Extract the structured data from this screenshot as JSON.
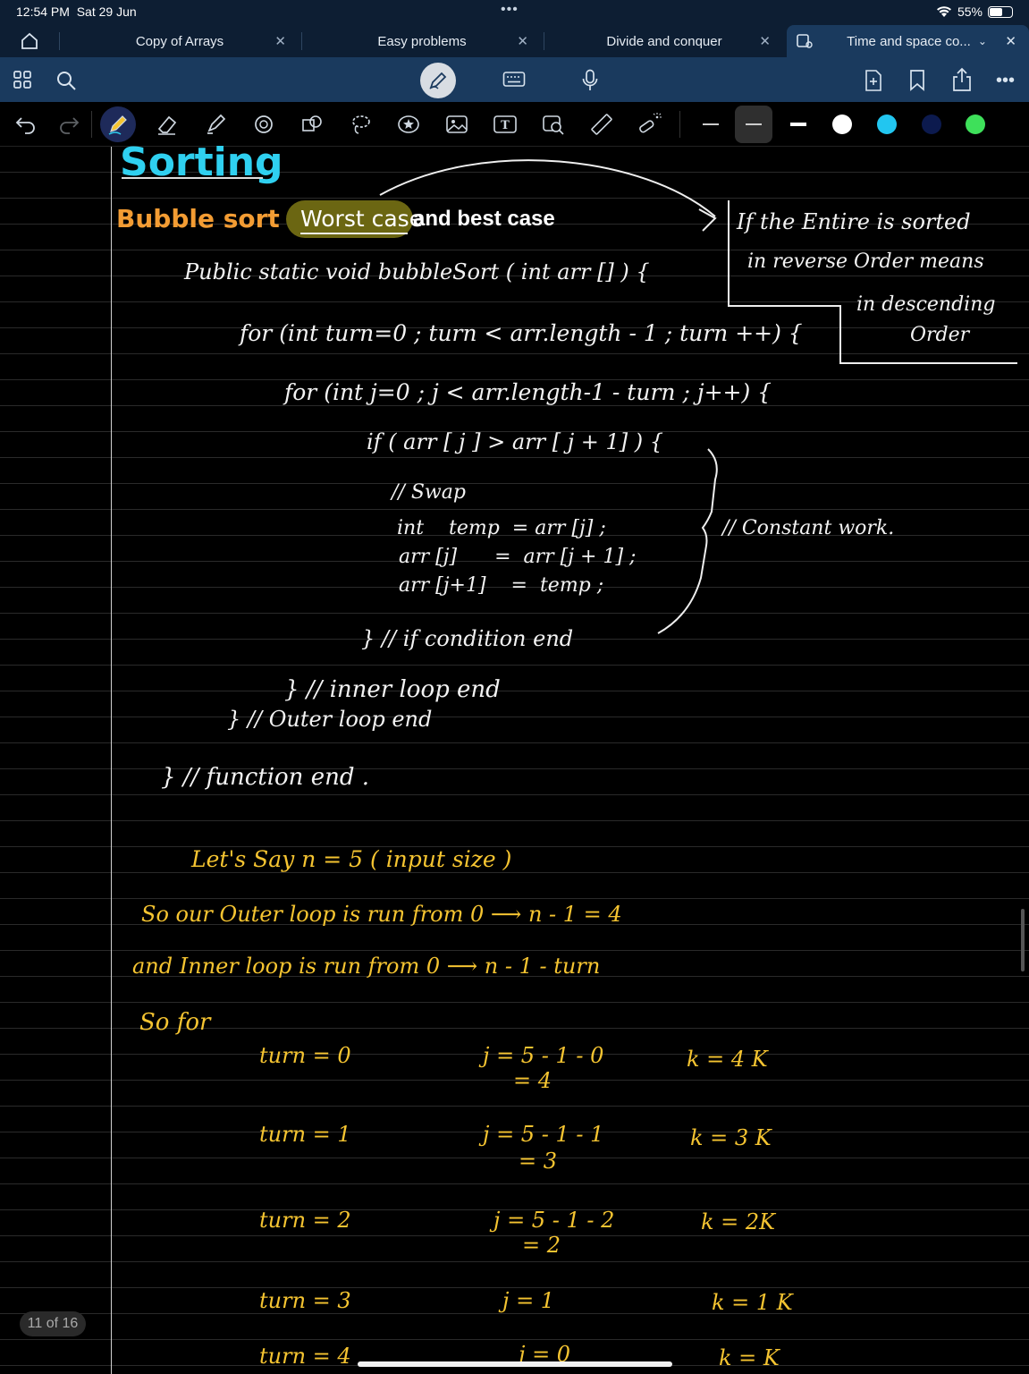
{
  "status_bar": {
    "time": "12:54 PM",
    "date": "Sat 29 Jun",
    "battery": "55%"
  },
  "tabs": [
    {
      "label": "Copy of Arrays"
    },
    {
      "label": "Easy problems"
    },
    {
      "label": "Divide and conquer"
    },
    {
      "label": "Time and space co..."
    }
  ],
  "icons": {
    "home": "home-icon",
    "grid": "grid-icon",
    "search": "search-icon",
    "pen_mode": "pen-mode-icon",
    "keyboard": "keyboard-icon",
    "mic": "microphone-icon",
    "add_page": "add-page-icon",
    "bookmark": "bookmark-icon",
    "share": "share-icon",
    "more": "more-icon"
  },
  "colors": {
    "swatches": [
      "#ffffff",
      "#22c6f0",
      "#0c1a4e",
      "#3ee05a"
    ],
    "accent": "#1a3a5e"
  },
  "note": {
    "title": "Sorting",
    "heading": "Bubble sort",
    "highlight": "Worst case",
    "heading_rest": "and best case",
    "side_note": [
      "If the Entire is sorted",
      "in reverse Order means",
      "in descending",
      "Order"
    ],
    "code": [
      "Public static void bubbleSort ( int arr [] ) {",
      "for (int turn=0 ; turn < arr.length - 1 ; turn ++) {",
      "for (int j=0 ; j < arr.length-1 - turn ; j++) {",
      "if ( arr [ j ] > arr [ j + 1] ) {",
      "// Swap",
      "int    temp  = arr [j] ;",
      "arr [j]      =  arr [j + 1] ;",
      "arr [j+1]    =  temp ;",
      "} // if condition end",
      "} // inner loop end",
      "} // Outer loop end",
      "} // function end ."
    ],
    "constant_work": "// Constant work.",
    "analysis": [
      "Let's  Say  n = 5  ( input size )",
      "So  our  Outer  loop  is  run  from 0  ⟶  n - 1 = 4",
      "and  Inner  loop  is  run  from   0  ⟶  n - 1 - turn",
      "So   for"
    ],
    "rows": [
      {
        "turn": "turn = 0",
        "j": "j = 5 - 1 - 0",
        "j2": "= 4",
        "k": "k = 4 K"
      },
      {
        "turn": "turn = 1",
        "j": "j = 5 - 1 - 1",
        "j2": "= 3",
        "k": "k = 3 K"
      },
      {
        "turn": "turn = 2",
        "j": "j = 5 - 1 - 2",
        "j2": "= 2",
        "k": "k = 2K"
      },
      {
        "turn": "turn = 3",
        "j": "j = 1",
        "j2": "",
        "k": "k = 1 K"
      },
      {
        "turn": "turn = 4",
        "j": "j = 0",
        "j2": "",
        "k": "k = K"
      }
    ]
  },
  "page_counter": "11 of 16"
}
